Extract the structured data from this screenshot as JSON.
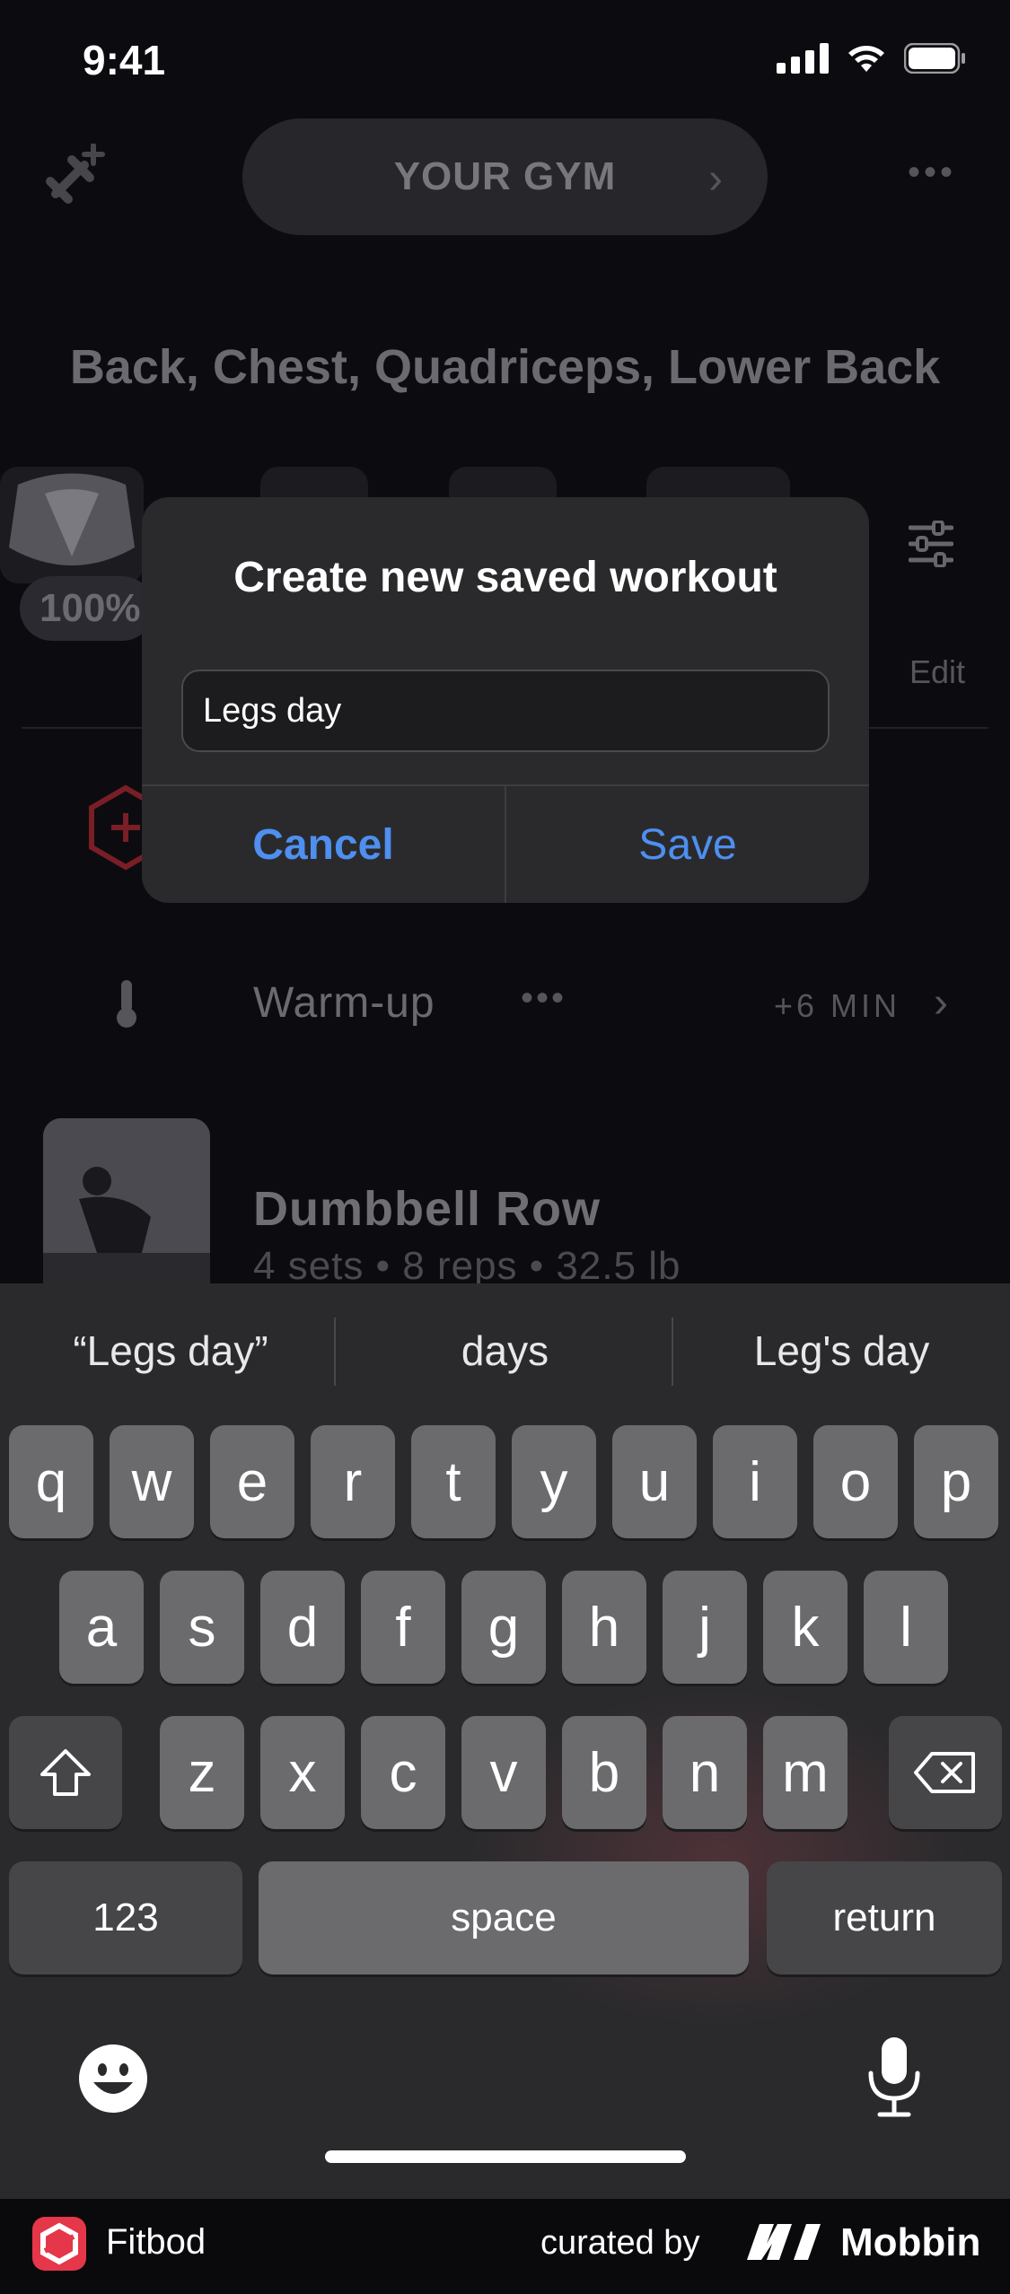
{
  "status_bar": {
    "time": "9:41"
  },
  "header": {
    "gym_label": "YOUR GYM"
  },
  "muscles_title": "Back, Chest, Quadriceps, Lower Back",
  "recovery_badge": "100%",
  "edit_label": "Edit",
  "warmup": {
    "label": "Warm-up",
    "duration": "+6 MIN"
  },
  "exercise": {
    "name": "Dumbbell Row",
    "detail": "4 sets • 8 reps • 32.5 lb"
  },
  "dialog": {
    "title": "Create new saved workout",
    "input_value": "Legs day",
    "cancel_label": "Cancel",
    "save_label": "Save"
  },
  "keyboard": {
    "suggestions": [
      "“Legs day”",
      "days",
      "Leg's day"
    ],
    "row1": [
      "q",
      "w",
      "e",
      "r",
      "t",
      "y",
      "u",
      "i",
      "o",
      "p"
    ],
    "row2": [
      "a",
      "s",
      "d",
      "f",
      "g",
      "h",
      "j",
      "k",
      "l"
    ],
    "row3": [
      "z",
      "x",
      "c",
      "v",
      "b",
      "n",
      "m"
    ],
    "numbers_label": "123",
    "space_label": "space",
    "return_label": "return"
  },
  "footer": {
    "app_name": "Fitbod",
    "curated_label": "curated by",
    "brand": "Mobbin"
  },
  "colors": {
    "accent": "#4e8ff0",
    "brand_red": "#e5364a"
  }
}
